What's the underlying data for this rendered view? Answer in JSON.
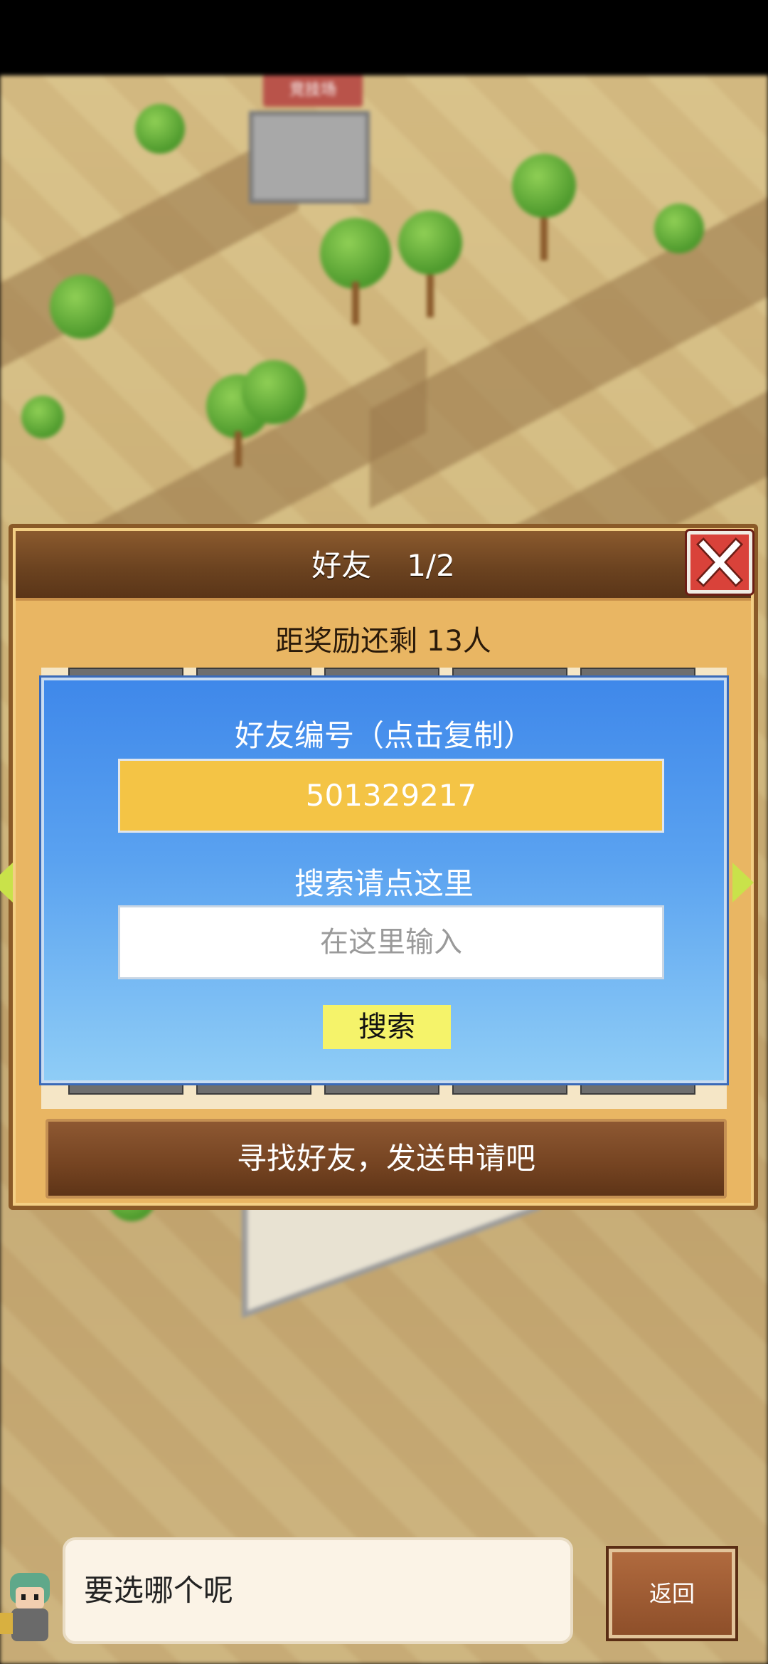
{
  "map": {
    "arena_sign": "竞技场"
  },
  "friends_panel": {
    "title": "好友",
    "page": "1/2",
    "reward_text": "距奖励还剩 13人",
    "find_friends_label": "寻找好友，发送申请吧"
  },
  "search_dialog": {
    "title": "好友编号（点击复制）",
    "friend_id": "501329217",
    "search_hint": "搜索请点这里",
    "input_placeholder": "在这里输入",
    "search_button": "搜索"
  },
  "footer": {
    "speech": "要选哪个呢",
    "back_label": "返回"
  },
  "icons": {
    "close": "close-icon",
    "left_arrow": "chevron-left-icon",
    "right_arrow": "chevron-right-icon"
  },
  "colors": {
    "panel": "#e9b663",
    "dialog_top": "#3f88ea",
    "friend_id_bg": "#f4c445",
    "search_button_bg": "#f5f36a",
    "close_button": "#d9423a"
  }
}
